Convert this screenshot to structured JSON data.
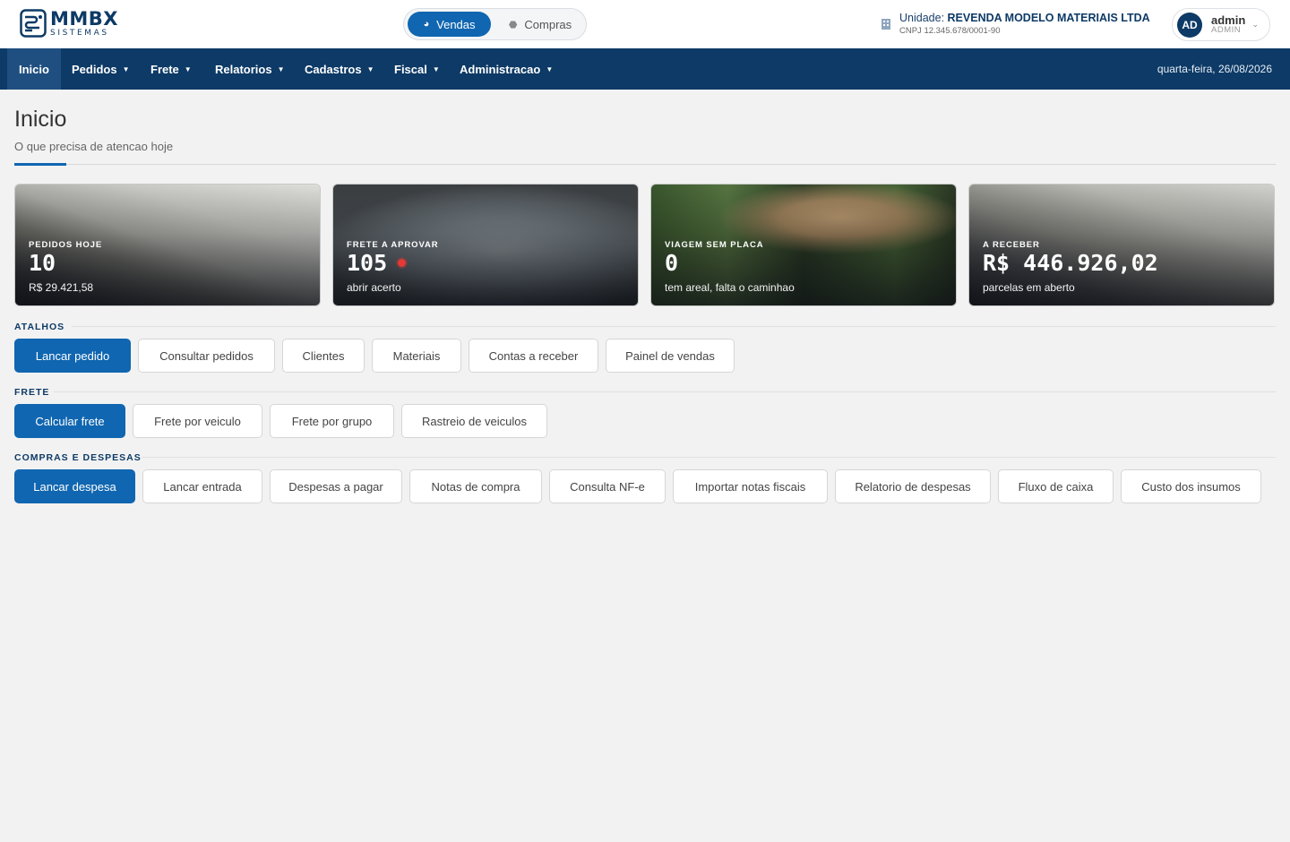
{
  "header": {
    "logo_name": "MMBX",
    "logo_sub": "SISTEMAS",
    "modes": {
      "vendas": "Vendas",
      "compras": "Compras"
    },
    "unit_label": "Unidade:",
    "unit_name": "REVENDA MODELO MATERIAIS LTDA",
    "unit_cnpj": "CNPJ 12.345.678/0001-90",
    "user_initials": "AD",
    "user_name": "admin",
    "user_role": "ADMIN"
  },
  "nav": {
    "items": [
      "Inicio",
      "Pedidos",
      "Frete",
      "Relatorios",
      "Cadastros",
      "Fiscal",
      "Administracao"
    ],
    "date": "quarta-feira, 26/08/2026"
  },
  "page": {
    "title": "Inicio",
    "subtitle": "O que precisa de atencao hoje"
  },
  "cards": [
    {
      "label": "PEDIDOS HOJE",
      "value": "10",
      "sub": "R$ 29.421,58"
    },
    {
      "label": "FRETE A APROVAR",
      "value": "105",
      "sub": "abrir acerto"
    },
    {
      "label": "VIAGEM SEM PLACA",
      "value": "0",
      "sub": "tem areal, falta o caminhao"
    },
    {
      "label": "A RECEBER",
      "value": "R$ 446.926,02",
      "sub": "parcelas em aberto"
    }
  ],
  "sections": {
    "atalhos": {
      "title": "ATALHOS",
      "buttons": [
        "Lancar pedido",
        "Consultar pedidos",
        "Clientes",
        "Materiais",
        "Contas a receber",
        "Painel de vendas"
      ]
    },
    "frete": {
      "title": "FRETE",
      "buttons": [
        "Calcular frete",
        "Frete por veiculo",
        "Frete por grupo",
        "Rastreio de veiculos"
      ]
    },
    "compras": {
      "title": "COMPRAS E DESPESAS",
      "buttons": [
        "Lancar despesa",
        "Lancar entrada",
        "Despesas a pagar",
        "Notas de compra",
        "Consulta NF-e",
        "Importar notas fiscais",
        "Relatorio de despesas",
        "Fluxo de caixa",
        "Custo dos insumos"
      ]
    }
  },
  "colors": {
    "brand": "#0d3a66",
    "primary": "#1066b0",
    "alert_dot": "#e53935"
  }
}
